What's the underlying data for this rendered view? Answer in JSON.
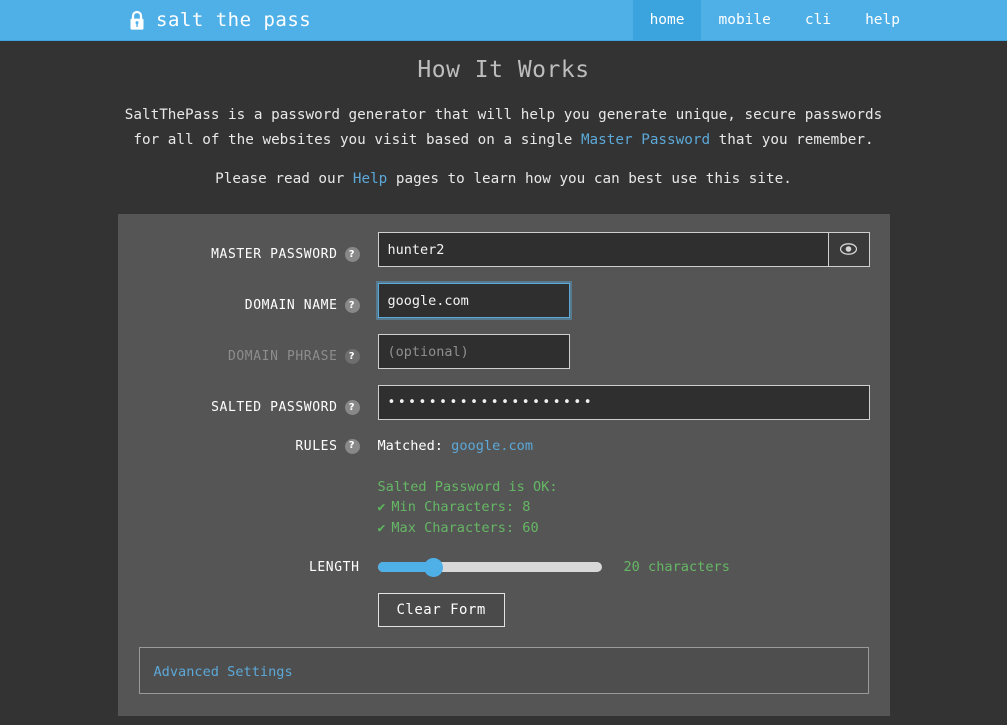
{
  "navbar": {
    "lock_icon": "lock-icon",
    "brand": "salt the pass",
    "links": [
      {
        "label": "home",
        "active": true
      },
      {
        "label": "mobile",
        "active": false
      },
      {
        "label": "cli",
        "active": false
      },
      {
        "label": "help",
        "active": false
      }
    ]
  },
  "page": {
    "title": "How It Works",
    "intro_part1": "SaltThePass is a password generator that will help you generate unique, secure passwords for all of the websites you visit based on a single ",
    "intro_link": "Master Password",
    "intro_part2": " that you remember.",
    "intro2_part1": "Please read our ",
    "intro2_link": "Help",
    "intro2_part2": " pages to learn how you can best use this site."
  },
  "form": {
    "master_password": {
      "label": "MASTER PASSWORD",
      "value": "hunter2",
      "placeholder": "",
      "help": "?",
      "toggle_icon": "eye-icon"
    },
    "domain_name": {
      "label": "DOMAIN NAME",
      "value": "google.com",
      "placeholder": "",
      "help": "?",
      "focused": true
    },
    "domain_phrase": {
      "label": "DOMAIN PHRASE",
      "value": "",
      "placeholder": "(optional)",
      "help": "?",
      "disabled": true
    },
    "salted_password": {
      "label": "SALTED PASSWORD",
      "value": "••••••••••••••••••••",
      "help": "?"
    },
    "rules": {
      "label": "RULES",
      "help": "?",
      "matched_prefix": "Matched: ",
      "matched_domain": "google.com",
      "status": "Salted Password is OK:",
      "items": [
        {
          "check": "✔",
          "text": "Min Characters: 8"
        },
        {
          "check": "✔",
          "text": "Max Characters: 60"
        }
      ]
    },
    "length": {
      "label": "LENGTH",
      "value_text": "20 characters",
      "percent": 25
    },
    "clear_button": "Clear Form",
    "advanced": "Advanced Settings"
  },
  "colors": {
    "brand_blue": "#4fb0e8",
    "nav_active": "#3ba3dd",
    "page_bg": "#333333",
    "panel_bg": "#555555",
    "link": "#5ca8d8",
    "success_green": "#65b765"
  }
}
